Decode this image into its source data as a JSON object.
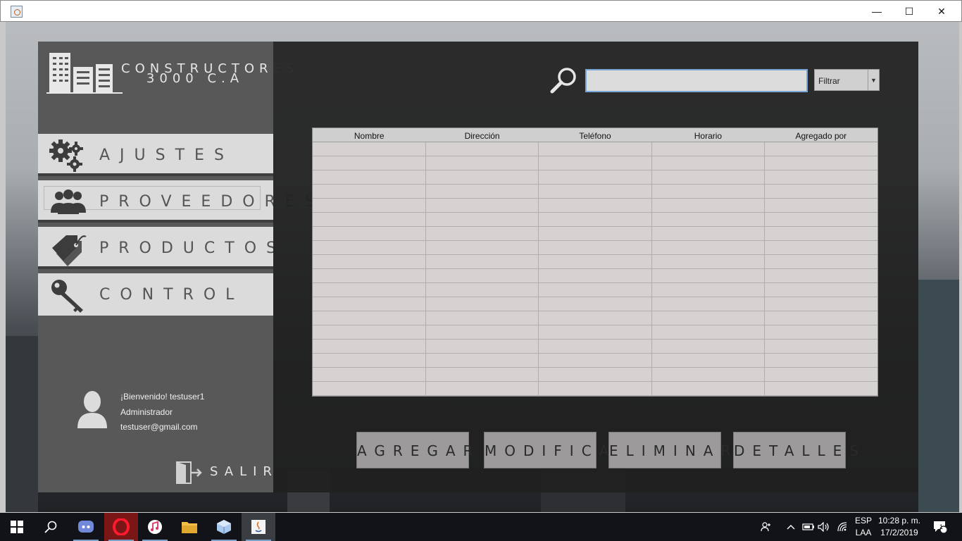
{
  "window": {
    "minimize_symbol": "—",
    "maximize_symbol": "☐",
    "close_symbol": "✕"
  },
  "app": {
    "company_line1": "CONSTRUCTORES",
    "company_line2": "3000 C.A"
  },
  "menu": [
    {
      "label": "AJUSTES",
      "icon": "gears-icon"
    },
    {
      "label": "PROVEEDORES",
      "icon": "users-icon"
    },
    {
      "label": "PRODUCTOS",
      "icon": "tags-icon"
    },
    {
      "label": "CONTROL",
      "icon": "key-icon"
    }
  ],
  "user": {
    "welcome": "¡Bienvenido! testuser1",
    "role": "Administrador",
    "email": "testuser@gmail.com"
  },
  "logout_label": "SALIR",
  "search": {
    "value": "",
    "filter_selected": "Filtrar",
    "arrow": "▼"
  },
  "table": {
    "columns": [
      "Nombre",
      "Dirección",
      "Teléfono",
      "Horario",
      "Agregado por"
    ],
    "rows": []
  },
  "actions": {
    "add": "AGREGAR",
    "modify": "MODIFICAR",
    "delete": "ELIMINAR",
    "details": "DETALLES"
  },
  "taskbar": {
    "apps": [
      "windows-start-icon",
      "search-icon",
      "discord-icon",
      "opera-icon",
      "itunes-icon",
      "file-explorer-icon",
      "virtualbox-icon",
      "java-icon"
    ],
    "lang_line1": "ESP",
    "lang_line2": "LAA",
    "time": "10:28 p. m.",
    "date": "17/2/2019",
    "notification_count": "1"
  }
}
